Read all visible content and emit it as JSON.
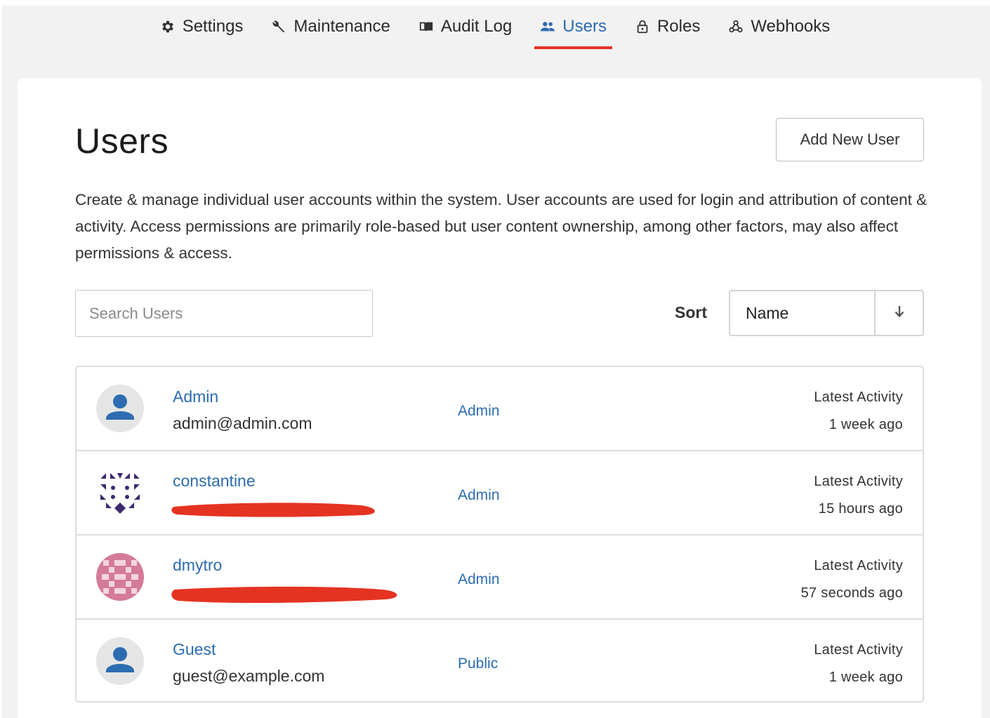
{
  "nav": {
    "items": [
      {
        "label": "Settings",
        "icon": "gear-icon"
      },
      {
        "label": "Maintenance",
        "icon": "wrench-icon"
      },
      {
        "label": "Audit Log",
        "icon": "book-icon"
      },
      {
        "label": "Users",
        "icon": "users-icon",
        "active": true
      },
      {
        "label": "Roles",
        "icon": "lock-icon"
      },
      {
        "label": "Webhooks",
        "icon": "webhook-icon"
      }
    ]
  },
  "page": {
    "title": "Users",
    "add_button": "Add New User",
    "description": "Create & manage individual user accounts within the system. User accounts are used for login and attribution of content & activity. Access permissions are primarily role-based but user content ownership, among other factors, may also affect permissions & access."
  },
  "filters": {
    "search_placeholder": "Search Users",
    "sort_label": "Sort",
    "sort_value": "Name"
  },
  "users": [
    {
      "name": "Admin",
      "email": "admin@admin.com",
      "role": "Admin",
      "activity_label": "Latest Activity",
      "activity_value": "1 week ago",
      "avatar": "default-avatar-icon"
    },
    {
      "name": "constantine",
      "email": "",
      "role": "Admin",
      "activity_label": "Latest Activity",
      "activity_value": "15 hours ago",
      "avatar": "identicon"
    },
    {
      "name": "dmytro",
      "email": "",
      "role": "Admin",
      "activity_label": "Latest Activity",
      "activity_value": "57 seconds ago",
      "avatar": "identicon"
    },
    {
      "name": "Guest",
      "email": "guest@example.com",
      "role": "Public",
      "activity_label": "Latest Activity",
      "activity_value": "1 week ago",
      "avatar": "default-avatar-icon"
    }
  ],
  "colors": {
    "link": "#2c6cb0",
    "active_underline": "#e53322",
    "redaction": "#e53322"
  }
}
